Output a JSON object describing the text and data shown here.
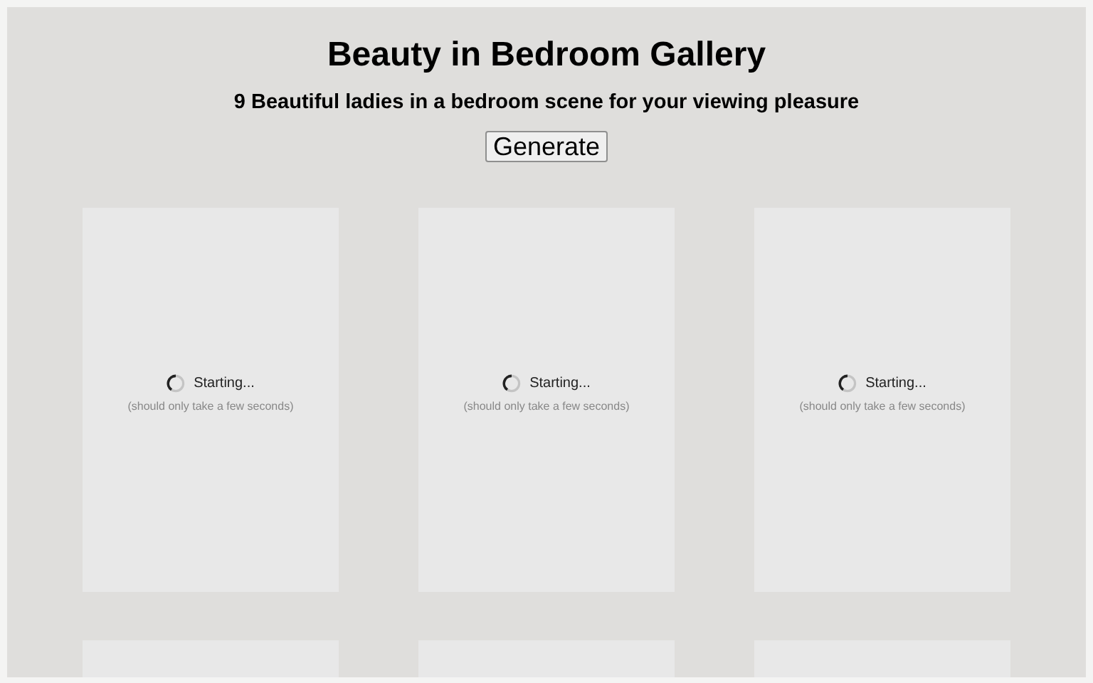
{
  "title": "Beauty in Bedroom Gallery",
  "subtitle": "9 Beautiful ladies in a bedroom scene for your viewing pleasure",
  "button": "Generate",
  "cards": [
    {
      "kind": "loading",
      "status": "Starting...",
      "note": "(should only take a few seconds)"
    },
    {
      "kind": "loading",
      "status": "Starting...",
      "note": "(should only take a few seconds)"
    },
    {
      "kind": "loading",
      "status": "Starting...",
      "note": "(should only take a few seconds)"
    },
    {
      "kind": "blank"
    },
    {
      "kind": "blank"
    },
    {
      "kind": "blank"
    }
  ]
}
